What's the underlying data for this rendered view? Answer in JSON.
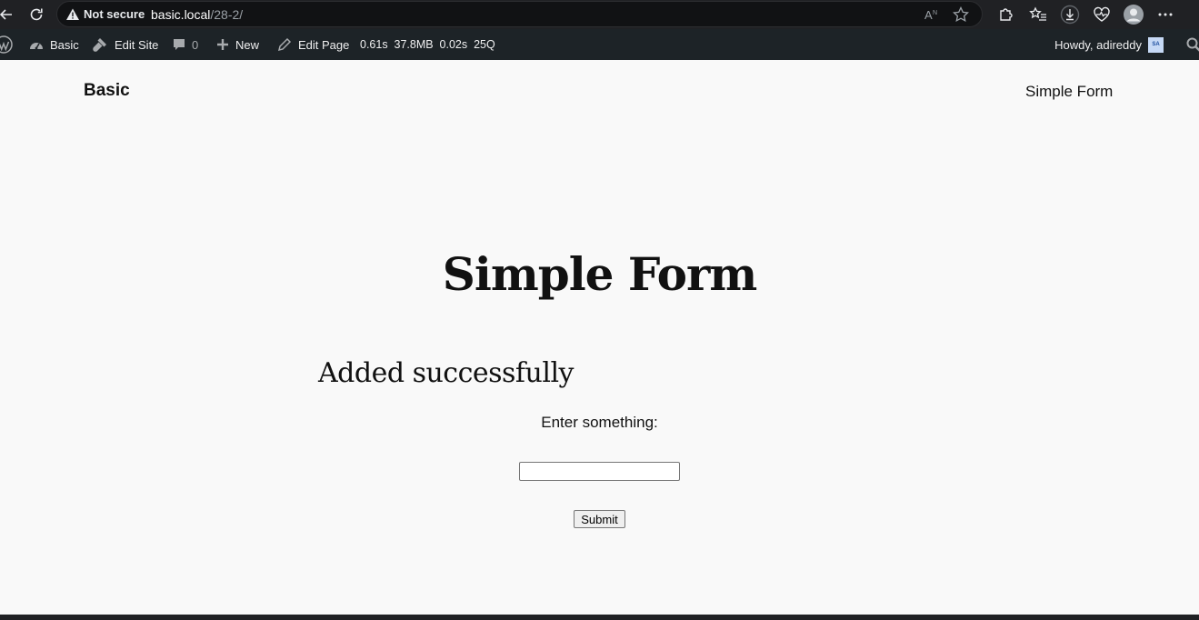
{
  "browser": {
    "security_label": "Not secure",
    "url_host": "basic.local",
    "url_path": "/28-2/"
  },
  "admin_bar": {
    "site_name": "Basic",
    "edit_site": "Edit Site",
    "comments_count": "0",
    "new_label": "New",
    "edit_page": "Edit Page",
    "stats": "0.61s  37.8MB  0.02s  25Q",
    "howdy": "Howdy, adireddy",
    "avatar_initials": "SA"
  },
  "site": {
    "title": "Basic",
    "nav_link": "Simple Form"
  },
  "content": {
    "page_title": "Simple Form",
    "success_message": "Added successfully",
    "form_label": "Enter something:",
    "input_value": "",
    "submit_label": "Submit"
  }
}
